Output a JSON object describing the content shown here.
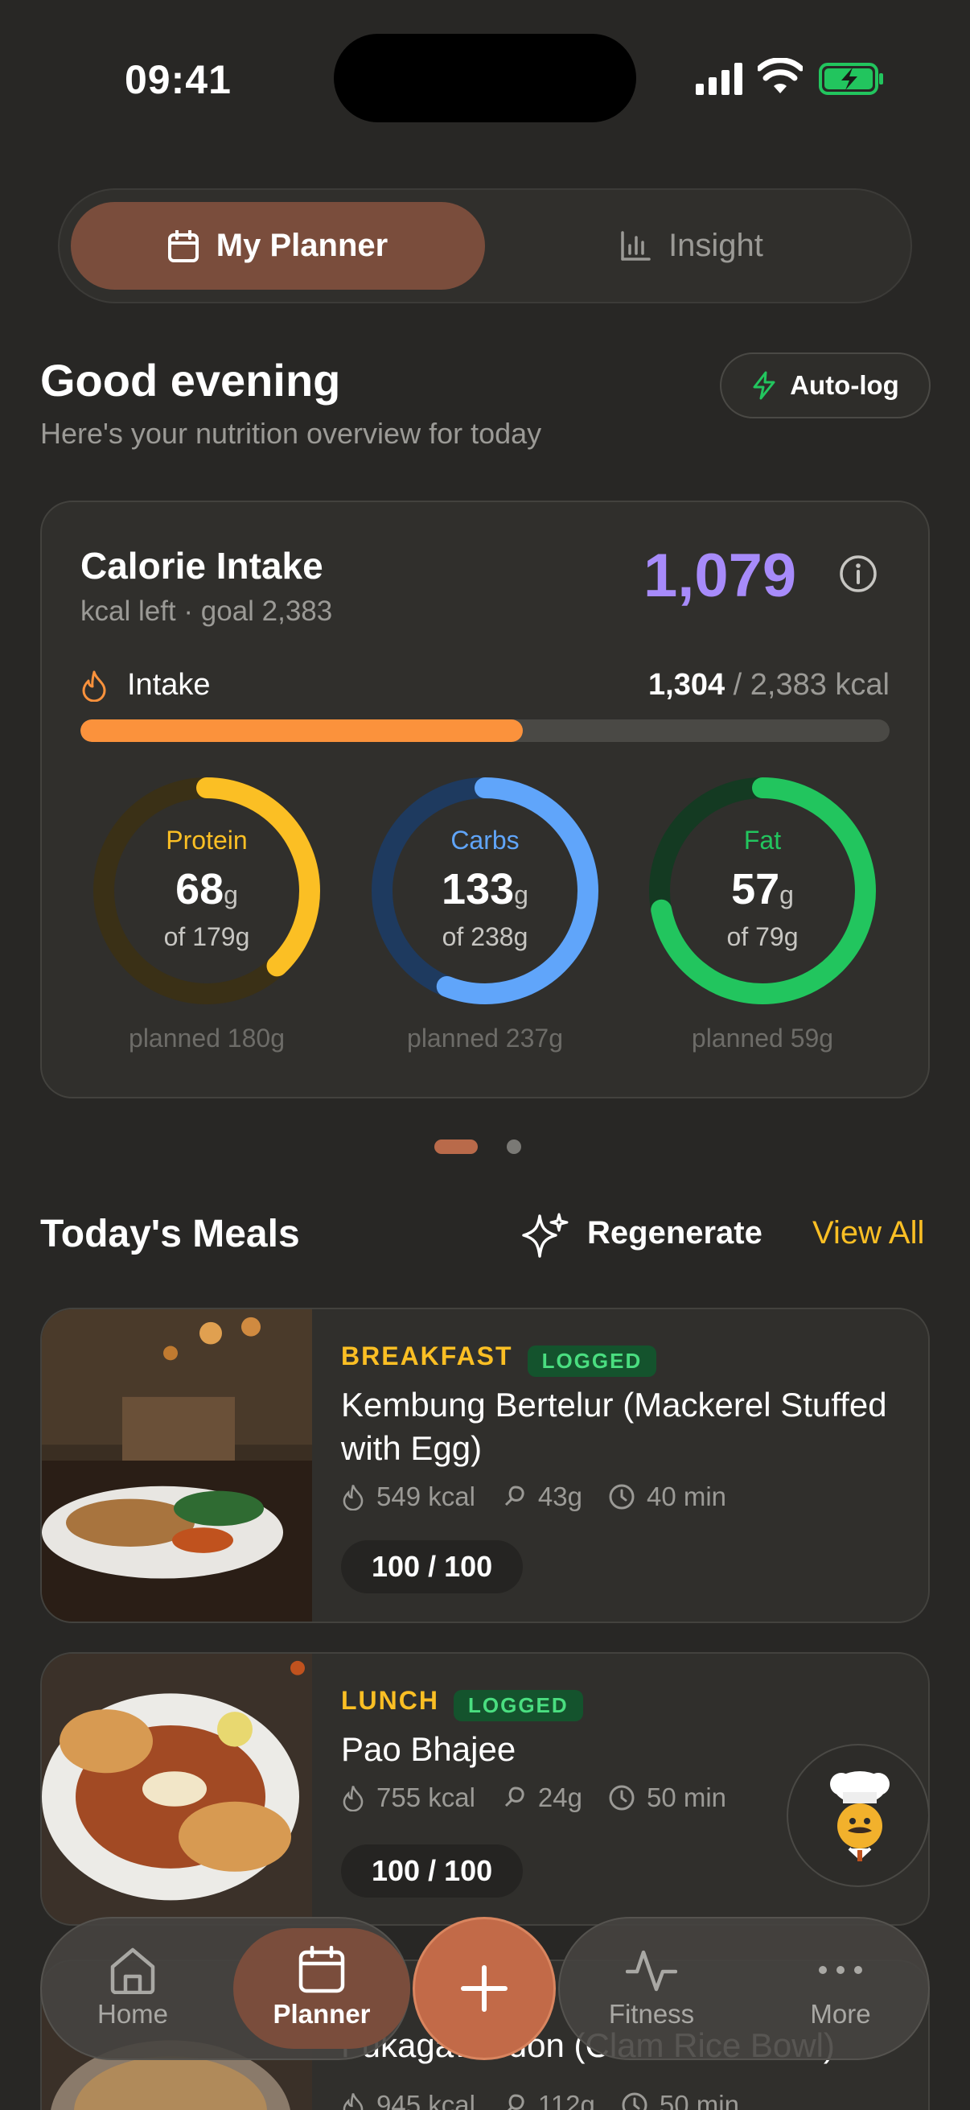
{
  "status_bar": {
    "time": "09:41"
  },
  "segmented": {
    "active": "My Planner",
    "inactive": "Insight"
  },
  "header": {
    "greeting": "Good evening",
    "subtitle": "Here's your nutrition overview for today",
    "autolog": "Auto-log"
  },
  "calorie_card": {
    "title": "Calorie Intake",
    "subtitle": "kcal left · goal 2,383",
    "remaining": "1,079",
    "intake_label": "Intake",
    "intake_value": "1,304",
    "intake_total": " / 2,383 kcal",
    "intake_fraction": 0.547
  },
  "macros": [
    {
      "name": "Protein",
      "value": "68",
      "unit": "g",
      "of": "of 179g",
      "planned": "planned 180g",
      "fraction": 0.38,
      "color": "#fbbf24",
      "track": "#3a3016"
    },
    {
      "name": "Carbs",
      "value": "133",
      "unit": "g",
      "of": "of 238g",
      "planned": "planned 237g",
      "fraction": 0.56,
      "color": "#60a5fa",
      "track": "#1e3a5f"
    },
    {
      "name": "Fat",
      "value": "57",
      "unit": "g",
      "of": "of 79g",
      "planned": "planned 59g",
      "fraction": 0.72,
      "color": "#22c55e",
      "track": "#143a22"
    }
  ],
  "meals_section": {
    "title": "Today's Meals",
    "regenerate": "Regenerate",
    "view_all": "View All"
  },
  "meals": [
    {
      "type": "BREAKFAST",
      "badge": "LOGGED",
      "name": "Kembung Bertelur (Mackerel Stuffed with Egg)",
      "kcal": "549 kcal",
      "protein": "43g",
      "time": "40 min",
      "score": "100 / 100"
    },
    {
      "type": "LUNCH",
      "badge": "LOGGED",
      "name": "Pao Bhajee",
      "kcal": "755 kcal",
      "protein": "24g",
      "time": "50 min",
      "score": "100 / 100"
    },
    {
      "type": "DINNER",
      "badge": "",
      "name": "Fukagawa-don (Clam Rice Bowl)",
      "kcal": "945 kcal",
      "protein": "112g",
      "time": "50 min",
      "score": ""
    }
  ],
  "nav": {
    "home": "Home",
    "planner": "Planner",
    "fitness": "Fitness",
    "more": "More"
  }
}
